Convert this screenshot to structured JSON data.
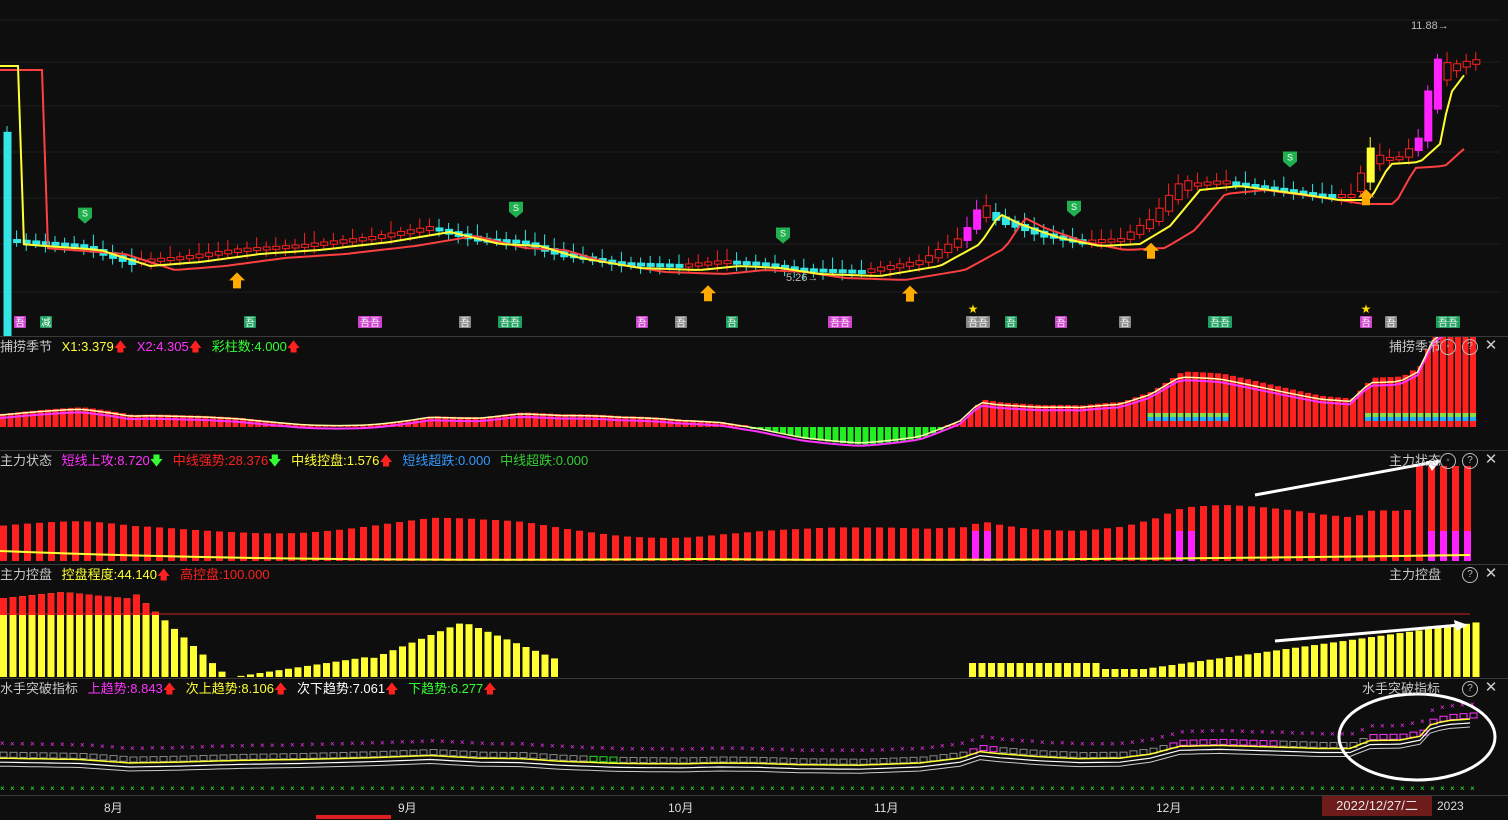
{
  "main": {
    "high_label": "11.88→",
    "low_label": "5.26→",
    "signal_tag": "S",
    "bottom_tags": [
      "吾",
      "减",
      "吾",
      "吾吾",
      "吾",
      "吾吾",
      "吾",
      "吾",
      "吾",
      "吾吾",
      "吾吾",
      "吾",
      "吾",
      "吾",
      "吾吾",
      "吾",
      "吾",
      "吾吾"
    ]
  },
  "panels": [
    {
      "name": "捕捞季节",
      "fields": [
        {
          "label": "X1:3.379",
          "color": "#ffff33",
          "arrow": "up"
        },
        {
          "label": "X2:4.305",
          "color": "#ff33ff",
          "arrow": "up"
        },
        {
          "label": "彩柱数:4.000",
          "color": "#33ff33",
          "arrow": "up"
        }
      ]
    },
    {
      "name": "主力状态",
      "fields": [
        {
          "label": "短线上攻:8.720",
          "color": "#ff33ff",
          "arrow": "down"
        },
        {
          "label": "中线强势:28.376",
          "color": "#ff2020",
          "arrow": "down"
        },
        {
          "label": "中线控盘:1.576",
          "color": "#ffff33",
          "arrow": "up"
        },
        {
          "label": "短线超跌:0.000",
          "color": "#3399ff",
          "arrow": ""
        },
        {
          "label": "中线超跌:0.000",
          "color": "#33cc33",
          "arrow": ""
        }
      ]
    },
    {
      "name": "主力控盘",
      "fields": [
        {
          "label": "控盘程度:44.140",
          "color": "#ffff33",
          "arrow": "up"
        },
        {
          "label": "高控盘:100.000",
          "color": "#ff2020",
          "arrow": ""
        }
      ]
    },
    {
      "name": "水手突破指标",
      "fields": [
        {
          "label": "上趋势:8.843",
          "color": "#ff33ff",
          "arrow": "up"
        },
        {
          "label": "次上趋势:8.106",
          "color": "#ffff33",
          "arrow": "up"
        },
        {
          "label": "次下趋势:7.061",
          "color": "#ffffff",
          "arrow": "up"
        },
        {
          "label": "下趋势:6.277",
          "color": "#33ff33",
          "arrow": "up"
        }
      ]
    }
  ],
  "panel_titles_right": [
    "捕捞季节",
    "主力状态",
    "主力控盘",
    "水手突破指标"
  ],
  "xaxis": {
    "months": [
      "8月",
      "9月",
      "10月",
      "11月",
      "12月",
      "2023"
    ],
    "cursor_date": "2022/12/27/二"
  },
  "colors": {
    "up": "#ff2020",
    "down": "#33e6e6",
    "ma_short": "#ffff33",
    "ma_long": "#ff4040"
  }
}
